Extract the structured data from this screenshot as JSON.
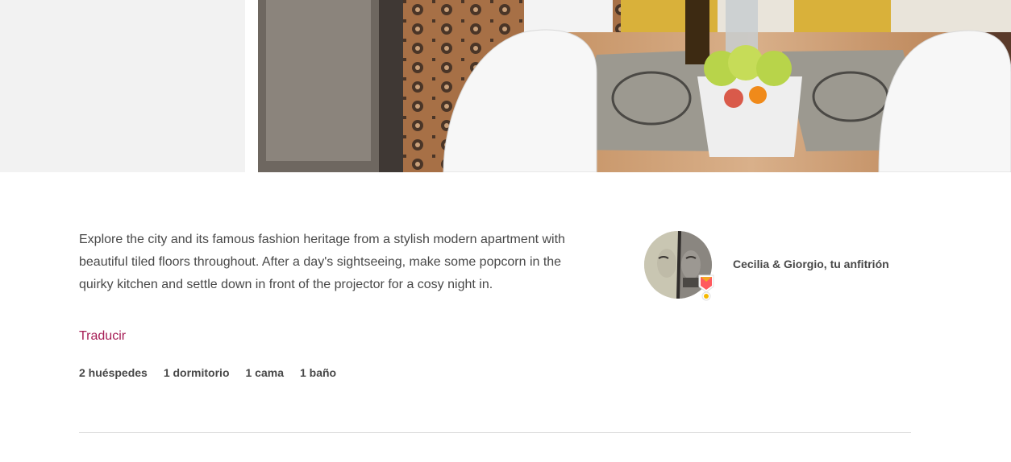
{
  "listing": {
    "description": "Explore the city and its famous fashion heritage from a stylish modern apartment with beautiful tiled floors throughout. After a day's sightseeing, make some popcorn in the quirky kitchen and settle down in front of the projector for a cosy night in.",
    "translate_label": "Traducir",
    "stats": [
      "2 huéspedes",
      "1 dormitorio",
      "1 cama",
      "1 baño"
    ]
  },
  "host": {
    "name_label": "Cecilia & Giorgio, tu anfitrión",
    "badge_icon": "superhost-badge-icon"
  },
  "theme": {
    "accent": "#a61d55",
    "text": "#484848",
    "divider": "#dcdcdc"
  }
}
